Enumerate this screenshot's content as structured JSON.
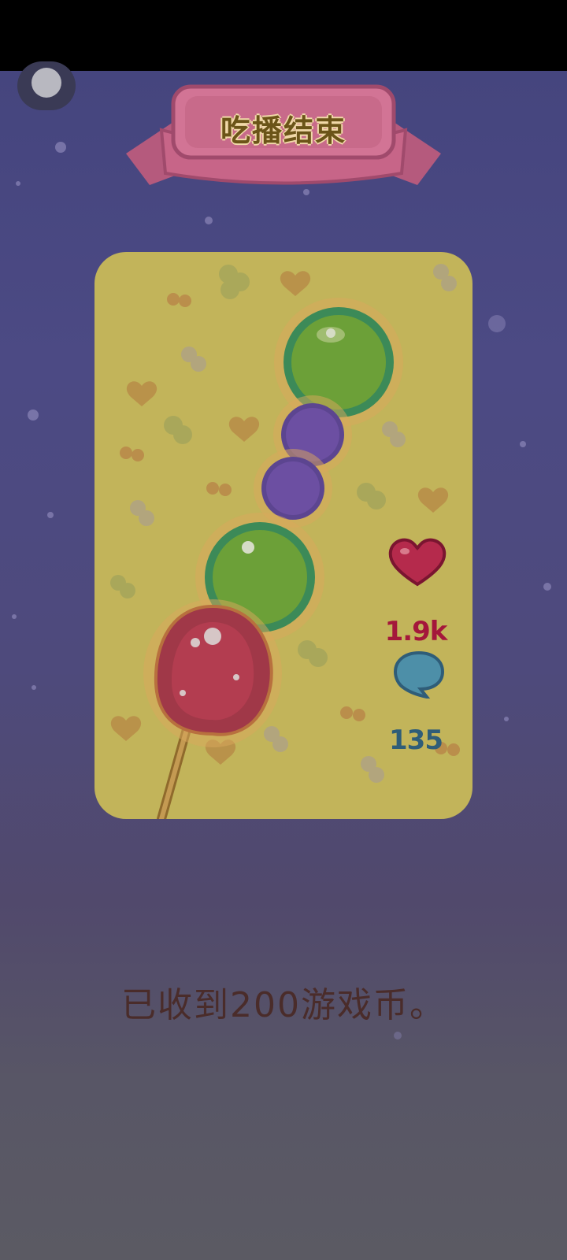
{
  "banner": {
    "title": "吃播结束"
  },
  "stats": {
    "likes": "1.9k",
    "comments": "135"
  },
  "reward": {
    "message": "已收到200游戏币。"
  },
  "colors": {
    "background_top": "#45457e",
    "background_bottom": "#5b5a63",
    "card": "#c2b45a",
    "banner_ribbon": "#c76588",
    "likes_text": "#a4173b",
    "comments_text": "#2f5d78",
    "message_text": "#4a2c2a"
  },
  "icons": {
    "menu": "menu-dot-icon",
    "like": "heart-icon",
    "comment": "speech-bubble-icon",
    "food": "tanghulu-skewer-icon"
  }
}
